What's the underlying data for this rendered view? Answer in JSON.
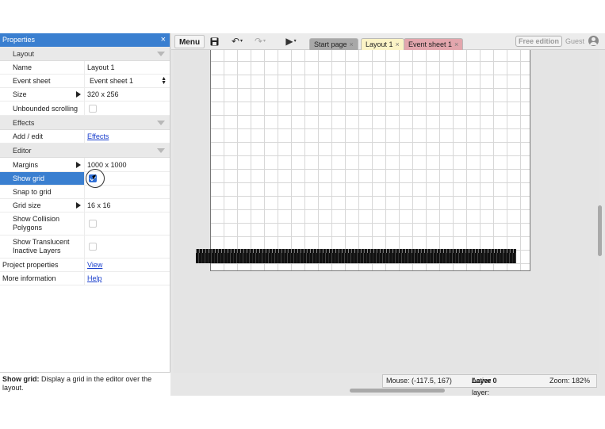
{
  "properties": {
    "title": "Properties",
    "close_icon": "×",
    "sections": {
      "layout": "Layout",
      "effects": "Effects",
      "editor": "Editor"
    },
    "rows": {
      "name": {
        "label": "Name",
        "value": "Layout 1"
      },
      "event_sheet": {
        "label": "Event sheet",
        "value": "Event sheet 1"
      },
      "size": {
        "label": "Size",
        "value": "320 x 256"
      },
      "unbounded_scrolling": {
        "label": "Unbounded scrolling",
        "checked": false
      },
      "add_edit": {
        "label": "Add / edit",
        "value": "Effects"
      },
      "margins": {
        "label": "Margins",
        "value": "1000 x 1000"
      },
      "show_grid": {
        "label": "Show grid",
        "checked": true
      },
      "snap_to_grid": {
        "label": "Snap to grid",
        "checked": false
      },
      "grid_size": {
        "label": "Grid size",
        "value": "16 x 16"
      },
      "show_collision": {
        "label_line1": "Show Collision",
        "label_line2": "Polygons",
        "checked": false
      },
      "show_translucent": {
        "label_line1": "Show Translucent",
        "label_line2": "Inactive Layers",
        "checked": false
      },
      "project_properties": {
        "label": "Project properties",
        "value": "View"
      },
      "more_information": {
        "label": "More information",
        "value": "Help"
      }
    },
    "help_bold": "Show grid:",
    "help_text": " Display a grid in the editor over the layout."
  },
  "toolbar": {
    "menu_label": "Menu",
    "tabs": [
      {
        "label": "Start page",
        "close": "×"
      },
      {
        "label": "Layout 1",
        "close": "×"
      },
      {
        "label": "Event sheet 1",
        "close": "×"
      }
    ],
    "free_edition": "Free edition",
    "guest": "Guest"
  },
  "status": {
    "mouse": "Mouse: (-117.5, 167)",
    "active_layer_label": "Active layer: ",
    "active_layer_value": "Layer 0",
    "zoom": "Zoom: 182%"
  },
  "colors": {
    "accent": "#3a7fd0",
    "link": "#1a3fcc",
    "tab_layout": "#fbf3c6",
    "tab_event": "#e3a6ad",
    "tab_start": "#a8a8a8"
  },
  "icons": [
    "close-icon",
    "save-icon",
    "undo-icon",
    "redo-icon",
    "play-icon",
    "user-icon"
  ]
}
